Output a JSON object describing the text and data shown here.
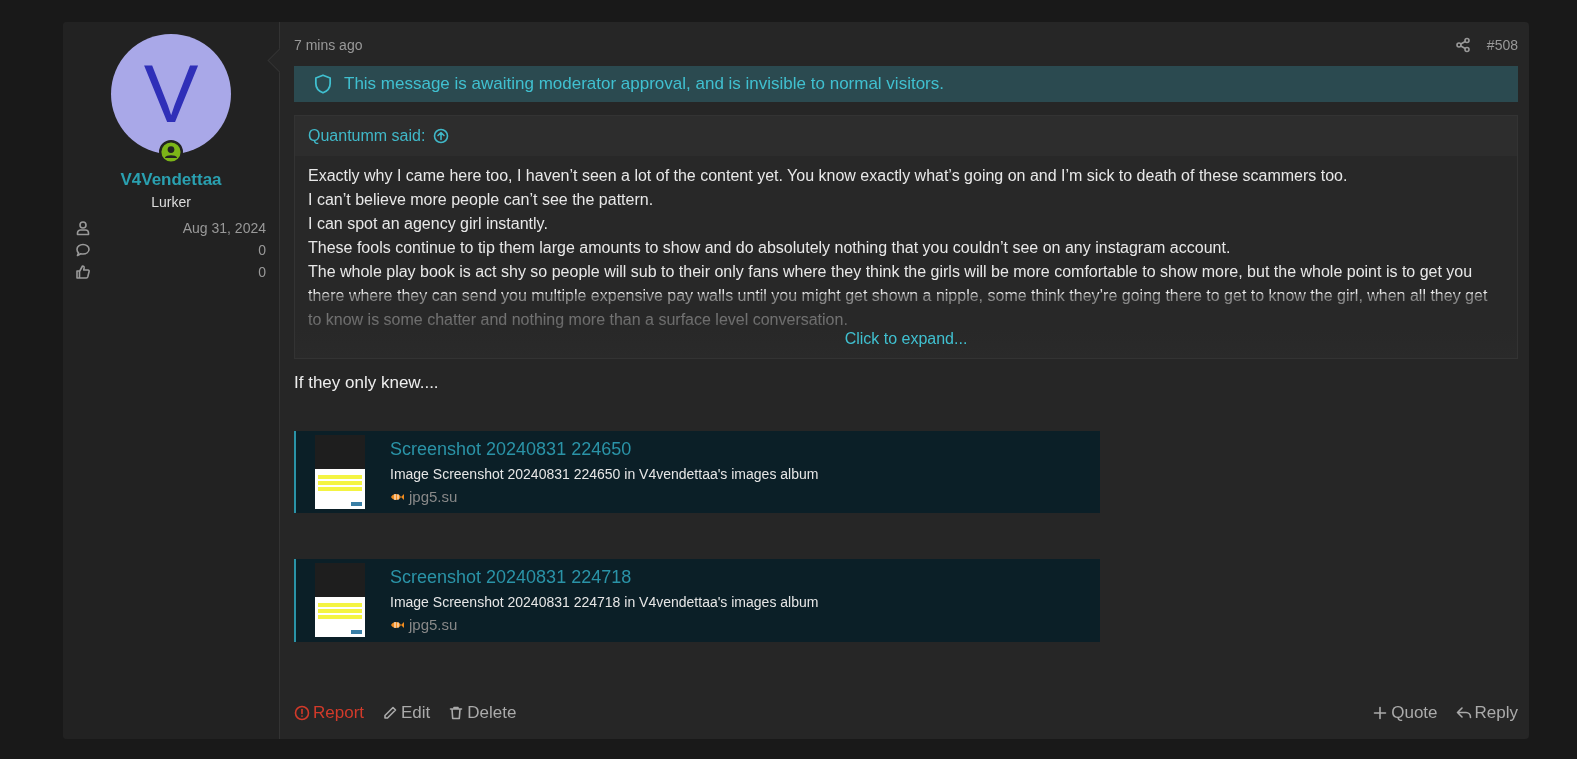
{
  "post": {
    "author": {
      "avatar_letter": "V",
      "online": true,
      "name": "V4Vendettaa",
      "title": "Lurker",
      "stats": [
        {
          "kind": "joined",
          "value": "Aug 31, 2024"
        },
        {
          "kind": "messages",
          "value": "0"
        },
        {
          "kind": "reactions",
          "value": "0"
        }
      ]
    },
    "time": "7 mins ago",
    "number": "#508",
    "notice": "This message is awaiting moderator approval, and is invisible to normal visitors.",
    "quote": {
      "author": "Quantumm said:",
      "lines": [
        "Exactly why I came here too, I haven’t seen a lot of the content yet. You know exactly what’s going on and I’m sick to death of these scammers too.",
        "I can’t believe more people can’t see the pattern.",
        "I can spot an agency girl instantly.",
        "These fools continue to tip them large amounts to show and do absolutely nothing that you couldn’t see on any instagram account.",
        "The whole play book is act shy so people will sub to their only fans where they think the girls will be more comfortable to show more, but the whole point is to get you there where they can send you multiple expensive pay walls until you might get shown a nipple, some think they’re going there to get to know the girl, when all they get to know is some chatter and nothing more than a surface level conversation."
      ],
      "expand": "Click to expand..."
    },
    "body": "If they only knew....",
    "embeds": [
      {
        "title": "Screenshot 20240831 224650",
        "description": "Image Screenshot 20240831 224650 in V4vendettaa's images album",
        "site": "jpg5.su"
      },
      {
        "title": "Screenshot 20240831 224718",
        "description": "Image Screenshot 20240831 224718 in V4vendettaa's images album",
        "site": "jpg5.su"
      }
    ],
    "actions_left": [
      {
        "kind": "report",
        "label": "Report"
      },
      {
        "kind": "edit",
        "label": "Edit"
      },
      {
        "kind": "delete",
        "label": "Delete"
      }
    ],
    "actions_right": [
      {
        "kind": "quote",
        "label": "Quote"
      },
      {
        "kind": "reply",
        "label": "Reply"
      }
    ]
  }
}
